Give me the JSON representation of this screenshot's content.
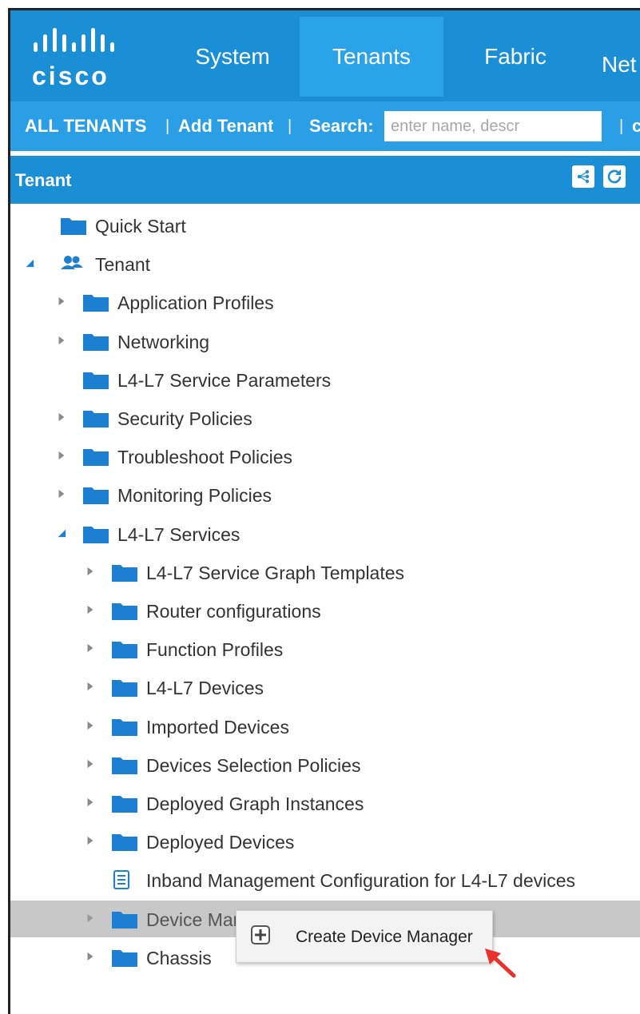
{
  "nav": {
    "logo": "cisco",
    "tabs": [
      {
        "label": "System",
        "active": false
      },
      {
        "label": "Tenants",
        "active": true
      },
      {
        "label": "Fabric",
        "active": false
      },
      {
        "label": "Net",
        "active": false
      }
    ]
  },
  "subbar": {
    "all_tenants": "ALL TENANTS",
    "sep1": "|",
    "add_tenant": "Add Tenant",
    "sep2": "|",
    "search_label": "Search:",
    "search_placeholder": "enter name, descr",
    "sep3": "|",
    "trailing": "c"
  },
  "panel": {
    "title": "Tenant",
    "buttons": [
      "topology-icon",
      "refresh-icon"
    ]
  },
  "tree": [
    {
      "label": "Quick Start",
      "icon": "folder-icon",
      "arrow": "none",
      "level": 0
    },
    {
      "label": "Tenant",
      "icon": "users-icon",
      "arrow": "expanded",
      "level": 0
    },
    {
      "label": "Application Profiles",
      "icon": "folder-icon",
      "arrow": "collapsed",
      "level": 1
    },
    {
      "label": "Networking",
      "icon": "folder-icon",
      "arrow": "collapsed",
      "level": 1
    },
    {
      "label": "L4-L7 Service Parameters",
      "icon": "folder-icon",
      "arrow": "none",
      "level": 1
    },
    {
      "label": "Security Policies",
      "icon": "folder-icon",
      "arrow": "collapsed",
      "level": 1
    },
    {
      "label": "Troubleshoot Policies",
      "icon": "folder-icon",
      "arrow": "collapsed",
      "level": 1
    },
    {
      "label": "Monitoring Policies",
      "icon": "folder-icon",
      "arrow": "collapsed",
      "level": 1
    },
    {
      "label": "L4-L7 Services",
      "icon": "folder-icon",
      "arrow": "expanded",
      "level": 1
    },
    {
      "label": "L4-L7 Service Graph Templates",
      "icon": "folder-icon",
      "arrow": "collapsed",
      "level": 2
    },
    {
      "label": "Router configurations",
      "icon": "folder-icon",
      "arrow": "collapsed",
      "level": 2
    },
    {
      "label": "Function Profiles",
      "icon": "folder-icon",
      "arrow": "collapsed",
      "level": 2
    },
    {
      "label": "L4-L7 Devices",
      "icon": "folder-icon",
      "arrow": "collapsed",
      "level": 2
    },
    {
      "label": "Imported Devices",
      "icon": "folder-icon",
      "arrow": "collapsed",
      "level": 2
    },
    {
      "label": "Devices Selection Policies",
      "icon": "folder-icon",
      "arrow": "collapsed",
      "level": 2
    },
    {
      "label": "Deployed Graph Instances",
      "icon": "folder-icon",
      "arrow": "collapsed",
      "level": 2
    },
    {
      "label": "Deployed Devices",
      "icon": "folder-icon",
      "arrow": "collapsed",
      "level": 2
    },
    {
      "label": "Inband Management Configuration for L4-L7 devices",
      "icon": "document-icon",
      "arrow": "none",
      "level": 2
    },
    {
      "label": "Device Managers",
      "icon": "folder-icon",
      "arrow": "collapsed",
      "level": 2,
      "selected": true
    },
    {
      "label": "Chassis",
      "icon": "folder-icon",
      "arrow": "collapsed",
      "level": 2
    }
  ],
  "context_menu": {
    "item_label": "Create Device Manager",
    "item_icon": "plus-square-icon"
  },
  "colors": {
    "nav_bg": "#1b8fd6",
    "nav_active": "#2ba3e8",
    "folder": "#1c7fd1",
    "selection": "#c8c8c8",
    "pointer": "#e8322c"
  }
}
